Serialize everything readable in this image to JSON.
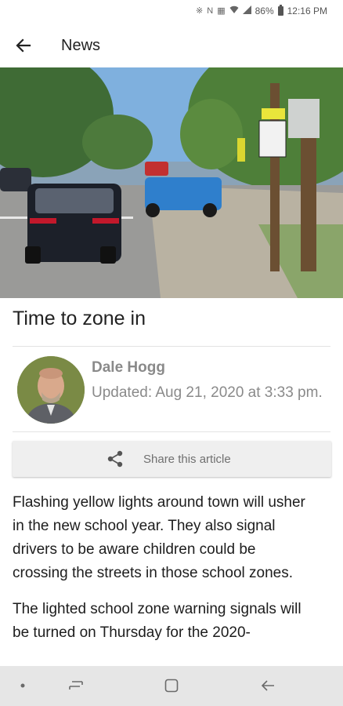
{
  "status_bar": {
    "icons": [
      "bluetooth-icon",
      "nfc-icon",
      "vibrate-icon",
      "wifi-icon",
      "signal-icon",
      "battery-icon"
    ],
    "battery": "86%",
    "time": "12:16 PM"
  },
  "app_bar": {
    "back_icon": "arrow-left-icon",
    "title": "News"
  },
  "article": {
    "headline": "Time to zone in",
    "author": {
      "name": "Dale Hogg",
      "updated": "Updated: Aug 21, 2020 at 3:33 pm."
    },
    "share": {
      "icon": "share-icon",
      "label": "Share this article"
    },
    "paragraphs": [
      "Flashing yellow lights around town will usher in the new school year. They also signal drivers to be aware children could be crossing the streets in those school zones.",
      "The lighted school zone warning signals will be turned on Thursday for the 2020-"
    ]
  },
  "nav_bar": {
    "items": [
      "dot-icon",
      "recent-apps-icon",
      "home-icon",
      "back-icon"
    ]
  },
  "colors": {
    "background": "#ffffff",
    "nav_bar": "#e6e6e6",
    "secondary_text": "#8a8a8a",
    "share_button": "#efefef"
  }
}
